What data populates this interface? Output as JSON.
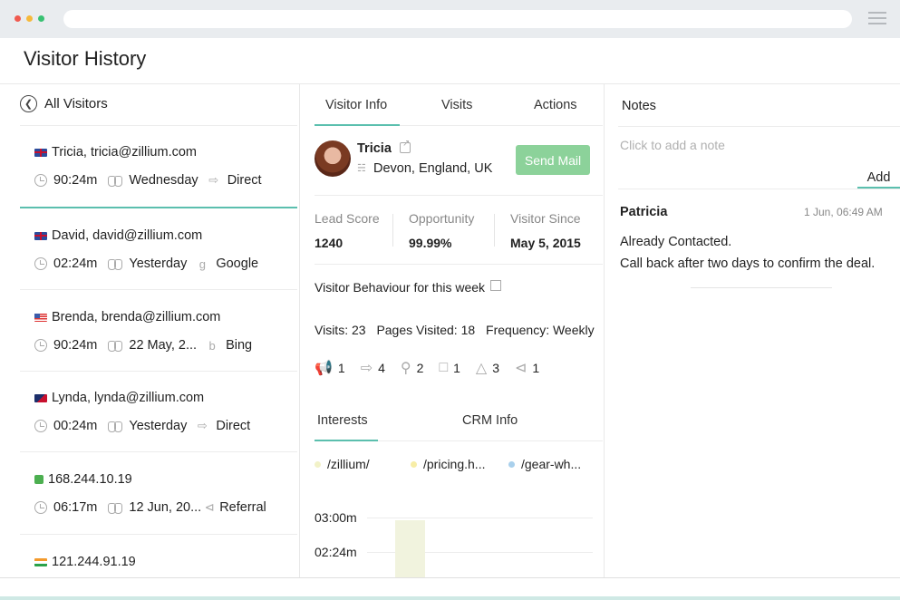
{
  "page": {
    "title": "Visitor History"
  },
  "visitors_panel": {
    "back_label": "All Visitors",
    "visitors": [
      {
        "name": "Tricia, tricia@zillium.com",
        "flag": "uk",
        "duration": "90:24m",
        "day": "Wednesday",
        "source": "Direct",
        "source_icon": "direct-icon",
        "active": true
      },
      {
        "name": "David, david@zillium.com",
        "flag": "uk",
        "duration": "02:24m",
        "day": "Yesterday",
        "source": "Google",
        "source_icon": "google-icon",
        "active": false
      },
      {
        "name": "Brenda, brenda@zillium.com",
        "flag": "us",
        "duration": "90:24m",
        "day": "22 May, 2...",
        "source": "Bing",
        "source_icon": "bing-icon",
        "active": false
      },
      {
        "name": "Lynda, lynda@zillium.com",
        "flag": "as",
        "duration": "00:24m",
        "day": "Yesterday",
        "source": "Direct",
        "source_icon": "direct-icon",
        "active": false
      },
      {
        "name": "168.244.10.19",
        "flag": "phone",
        "duration": "06:17m",
        "day": "12 Jun, 20...",
        "source": "Referral",
        "source_icon": "share-icon",
        "active": false
      },
      {
        "name": "121.244.91.19",
        "flag": "in",
        "duration": "",
        "day": "",
        "source": "",
        "source_icon": "",
        "active": false
      }
    ]
  },
  "detail_panel": {
    "tabs": [
      "Visitor Info",
      "Visits",
      "Actions"
    ],
    "active_tab": "Visitor Info",
    "contact": {
      "name": "Tricia",
      "location": "Devon, England, UK"
    },
    "send_mail_label": "Send Mail",
    "stats": [
      {
        "label": "Lead Score",
        "value": "1240"
      },
      {
        "label": "Opportunity",
        "value": "99.99%"
      },
      {
        "label": "Visitor Since",
        "value": "May 5, 2015"
      }
    ],
    "behaviour": {
      "title": "Visitor Behaviour for this week",
      "visits": "Visits: 23",
      "pages_visited": "Pages Visited: 18",
      "frequency": "Frequency: Weekly",
      "icon_counts": [
        {
          "icon": "megaphone-icon",
          "count": "1"
        },
        {
          "icon": "entry-icon",
          "count": "4"
        },
        {
          "icon": "search-icon",
          "count": "2"
        },
        {
          "icon": "dollar-icon",
          "count": "1"
        },
        {
          "icon": "network-icon",
          "count": "3"
        },
        {
          "icon": "share-icon",
          "count": "1"
        }
      ]
    },
    "sub_tabs": [
      "Interests",
      "CRM Info"
    ],
    "active_sub_tab": "Interests",
    "chart_data": {
      "type": "bar",
      "series": [
        {
          "name": "/zillium/",
          "color": "#f2f2c8"
        },
        {
          "name": "/pricing.h...",
          "color": "#f7eda6"
        },
        {
          "name": "/gear-wh...",
          "color": "#a9d0ec"
        }
      ],
      "y_ticks": [
        "03:00m",
        "02:24m"
      ],
      "colors": {
        "bar": "#f1f3de"
      }
    }
  },
  "notes_panel": {
    "title": "Notes",
    "placeholder": "Click to add a note",
    "add_label": "Add",
    "note": {
      "author": "Patricia",
      "time": "1 Jun,  06:49 AM",
      "lines": [
        "Already Contacted.",
        "Call back after two days to confirm the deal."
      ]
    }
  },
  "theme": {
    "accent": "#5bbfae",
    "button": "#8cd29a"
  }
}
